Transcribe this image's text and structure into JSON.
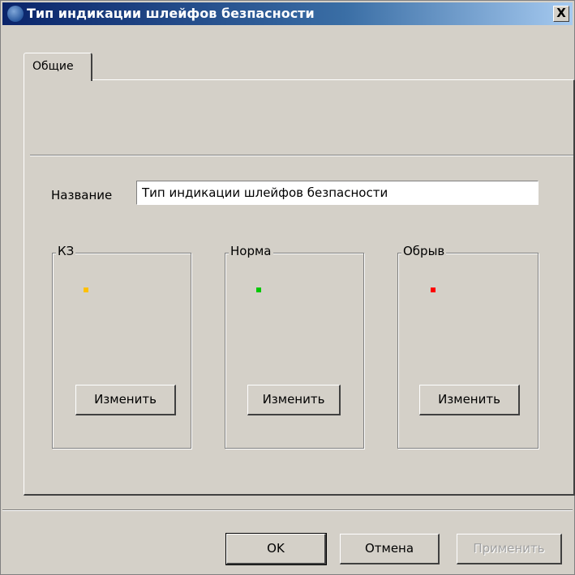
{
  "window": {
    "title": "Тип индикации шлейфов безпасности",
    "close_label": "X"
  },
  "tabs": [
    {
      "label": "Общие"
    }
  ],
  "form": {
    "name_label": "Название",
    "name_value": "Тип индикации шлейфов безпасности"
  },
  "groups": [
    {
      "title": "КЗ",
      "indicator_color": "#ffc000",
      "button_label": "Изменить"
    },
    {
      "title": "Норма",
      "indicator_color": "#00c800",
      "button_label": "Изменить"
    },
    {
      "title": "Обрыв",
      "indicator_color": "#ff0000",
      "button_label": "Изменить"
    }
  ],
  "footer": {
    "ok_label": "OK",
    "cancel_label": "Отмена",
    "apply_label": "Применить"
  }
}
